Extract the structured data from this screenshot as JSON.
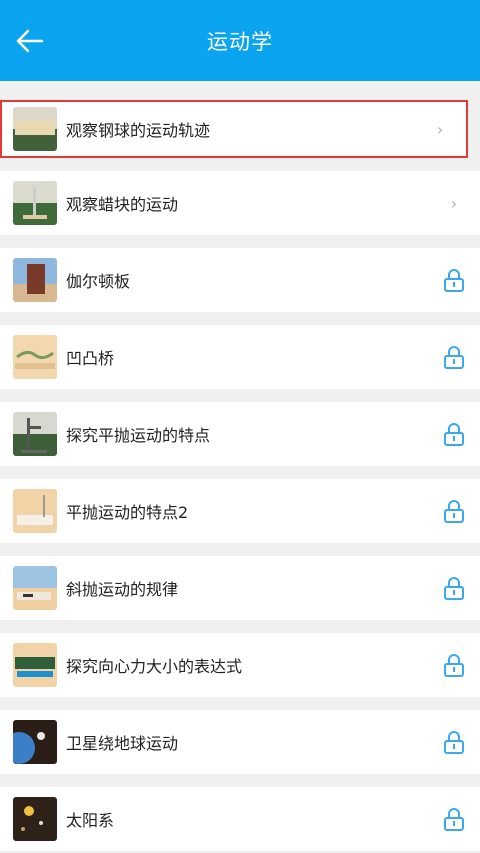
{
  "header": {
    "title": "运动学"
  },
  "items": [
    {
      "label": "观察钢球的运动轨迹",
      "state": "open",
      "thumb": "table-scene-icon"
    },
    {
      "label": "观察蜡块的运动",
      "state": "open",
      "thumb": "tube-stand-icon"
    },
    {
      "label": "伽尔顿板",
      "state": "locked",
      "thumb": "galton-board-icon"
    },
    {
      "label": "凹凸桥",
      "state": "locked",
      "thumb": "bridge-icon"
    },
    {
      "label": "探究平抛运动的特点",
      "state": "locked",
      "thumb": "stand-apparatus-icon"
    },
    {
      "label": "平抛运动的特点2",
      "state": "locked",
      "thumb": "table-apparatus-icon"
    },
    {
      "label": "斜抛运动的规律",
      "state": "locked",
      "thumb": "projectile-table-icon"
    },
    {
      "label": "探究向心力大小的表达式",
      "state": "locked",
      "thumb": "centripetal-device-icon"
    },
    {
      "label": "卫星绕地球运动",
      "state": "locked",
      "thumb": "satellite-earth-icon"
    },
    {
      "label": "太阳系",
      "state": "locked",
      "thumb": "solar-system-icon"
    }
  ],
  "colors": {
    "header": "#0aa4f1",
    "lock": "#3aa7ef",
    "highlight": "#e53935"
  }
}
